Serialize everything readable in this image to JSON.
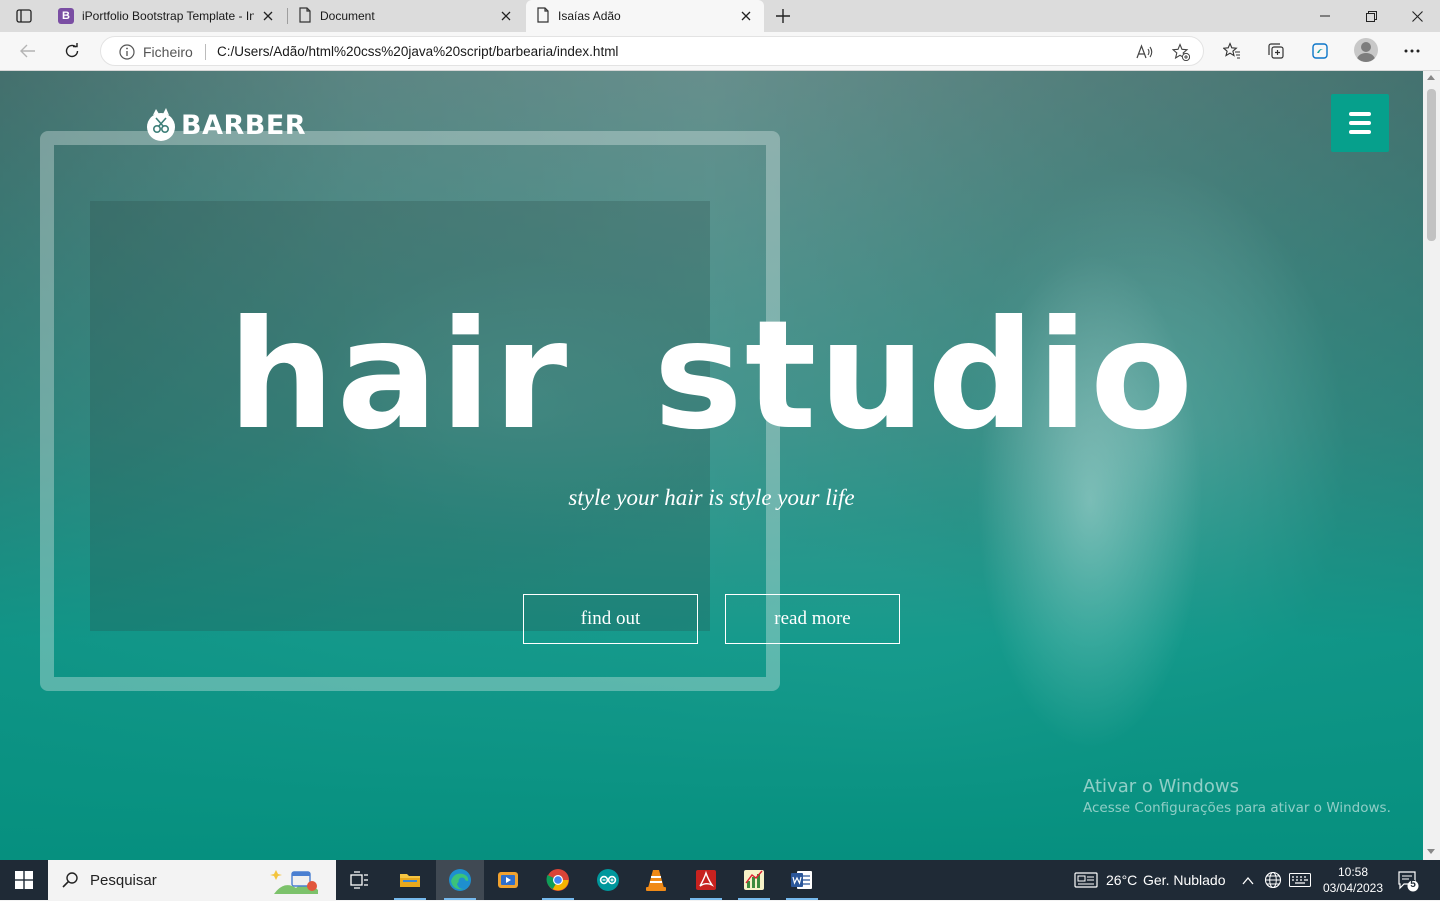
{
  "browser": {
    "tabs": [
      {
        "title": "iPortfolio Bootstrap Template - In",
        "favicon": "B"
      },
      {
        "title": "Document"
      },
      {
        "title": "Isaías Adão"
      }
    ],
    "active_tab": 2,
    "address": {
      "scheme_label": "Ficheiro",
      "url": "C:/Users/Adão/html%20css%20java%20script/barbearia/index.html"
    }
  },
  "page": {
    "logo_text": "BARBER",
    "hero_title": "hair studio",
    "hero_subtitle": "style your hair is style your life",
    "buttons": {
      "find_out": "find out",
      "read_more": "read more"
    },
    "accent_color": "#06a08c"
  },
  "watermark": {
    "line1": "Ativar o Windows",
    "line2": "Acesse Configurações para ativar o Windows."
  },
  "taskbar": {
    "search_placeholder": "Pesquisar",
    "weather": "26°C",
    "weather_desc": "Ger. Nublado",
    "time": "10:58",
    "date": "03/04/2023",
    "notifications": "5"
  }
}
